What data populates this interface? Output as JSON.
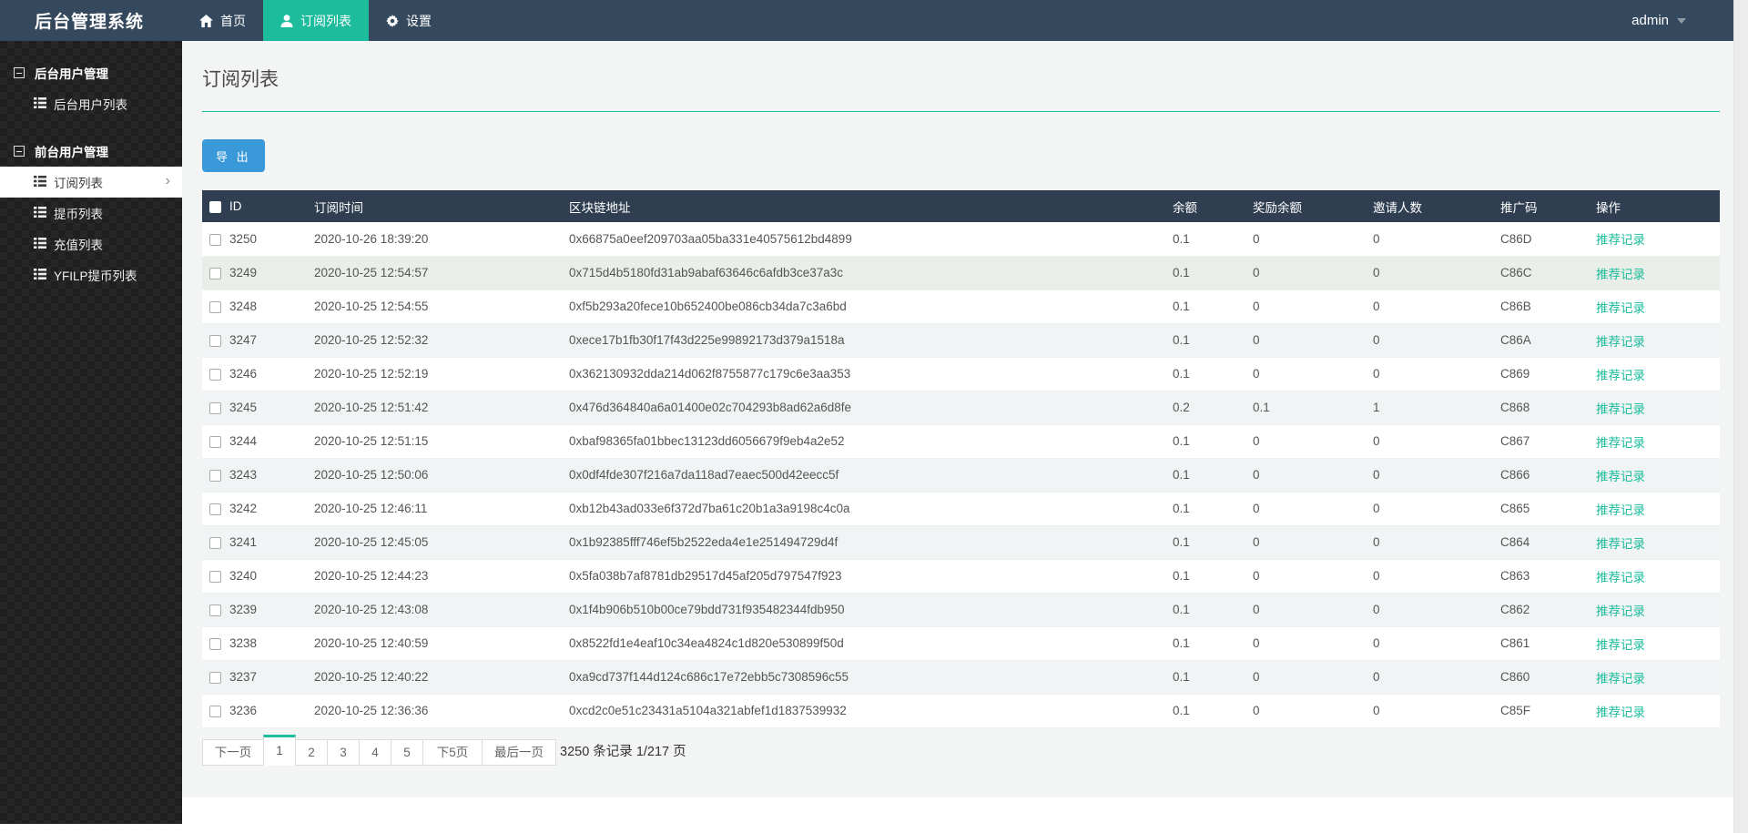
{
  "navbar": {
    "brand": "后台管理系统",
    "items": [
      {
        "label": "首页",
        "icon": "home-icon",
        "active": false
      },
      {
        "label": "订阅列表",
        "icon": "user-icon",
        "active": true
      },
      {
        "label": "设置",
        "icon": "gear-icon",
        "active": false
      }
    ],
    "user": "admin"
  },
  "sidebar": {
    "sections": [
      {
        "title": "后台用户管理",
        "items": [
          {
            "label": "后台用户列表",
            "active": false
          }
        ]
      },
      {
        "title": "前台用户管理",
        "items": [
          {
            "label": "订阅列表",
            "active": true
          },
          {
            "label": "提币列表",
            "active": false
          },
          {
            "label": "充值列表",
            "active": false
          },
          {
            "label": "YFILP提币列表",
            "active": false
          }
        ]
      }
    ]
  },
  "page": {
    "title": "订阅列表",
    "export_label": "导 出"
  },
  "table": {
    "headers": [
      "ID",
      "订阅时间",
      "区块链地址",
      "余额",
      "奖励余额",
      "邀请人数",
      "推广码",
      "操作"
    ],
    "action_label": "推荐记录",
    "rows": [
      {
        "id": "3250",
        "time": "2020-10-26 18:39:20",
        "address": "0x66875a0eef209703aa05ba331e40575612bd4899",
        "balance": "0.1",
        "reward": "0",
        "invites": "0",
        "code": "C86D"
      },
      {
        "id": "3249",
        "time": "2020-10-25 12:54:57",
        "address": "0x715d4b5180fd31ab9abaf63646c6afdb3ce37a3c",
        "balance": "0.1",
        "reward": "0",
        "invites": "0",
        "code": "C86C"
      },
      {
        "id": "3248",
        "time": "2020-10-25 12:54:55",
        "address": "0xf5b293a20fece10b652400be086cb34da7c3a6bd",
        "balance": "0.1",
        "reward": "0",
        "invites": "0",
        "code": "C86B"
      },
      {
        "id": "3247",
        "time": "2020-10-25 12:52:32",
        "address": "0xece17b1fb30f17f43d225e99892173d379a1518a",
        "balance": "0.1",
        "reward": "0",
        "invites": "0",
        "code": "C86A"
      },
      {
        "id": "3246",
        "time": "2020-10-25 12:52:19",
        "address": "0x362130932dda214d062f8755877c179c6e3aa353",
        "balance": "0.1",
        "reward": "0",
        "invites": "0",
        "code": "C869"
      },
      {
        "id": "3245",
        "time": "2020-10-25 12:51:42",
        "address": "0x476d364840a6a01400e02c704293b8ad62a6d8fe",
        "balance": "0.2",
        "reward": "0.1",
        "invites": "1",
        "code": "C868"
      },
      {
        "id": "3244",
        "time": "2020-10-25 12:51:15",
        "address": "0xbaf98365fa01bbec13123dd6056679f9eb4a2e52",
        "balance": "0.1",
        "reward": "0",
        "invites": "0",
        "code": "C867"
      },
      {
        "id": "3243",
        "time": "2020-10-25 12:50:06",
        "address": "0x0df4fde307f216a7da118ad7eaec500d42eecc5f",
        "balance": "0.1",
        "reward": "0",
        "invites": "0",
        "code": "C866"
      },
      {
        "id": "3242",
        "time": "2020-10-25 12:46:11",
        "address": "0xb12b43ad033e6f372d7ba61c20b1a3a9198c4c0a",
        "balance": "0.1",
        "reward": "0",
        "invites": "0",
        "code": "C865"
      },
      {
        "id": "3241",
        "time": "2020-10-25 12:45:05",
        "address": "0x1b92385fff746ef5b2522eda4e1e251494729d4f",
        "balance": "0.1",
        "reward": "0",
        "invites": "0",
        "code": "C864"
      },
      {
        "id": "3240",
        "time": "2020-10-25 12:44:23",
        "address": "0x5fa038b7af8781db29517d45af205d797547f923",
        "balance": "0.1",
        "reward": "0",
        "invites": "0",
        "code": "C863"
      },
      {
        "id": "3239",
        "time": "2020-10-25 12:43:08",
        "address": "0x1f4b906b510b00ce79bdd731f935482344fdb950",
        "balance": "0.1",
        "reward": "0",
        "invites": "0",
        "code": "C862"
      },
      {
        "id": "3238",
        "time": "2020-10-25 12:40:59",
        "address": "0x8522fd1e4eaf10c34ea4824c1d820e530899f50d",
        "balance": "0.1",
        "reward": "0",
        "invites": "0",
        "code": "C861"
      },
      {
        "id": "3237",
        "time": "2020-10-25 12:40:22",
        "address": "0xa9cd737f144d124c686c17e72ebb5c7308596c55",
        "balance": "0.1",
        "reward": "0",
        "invites": "0",
        "code": "C860"
      },
      {
        "id": "3236",
        "time": "2020-10-25 12:36:36",
        "address": "0xcd2c0e51c23431a5104a321abfef1d1837539932",
        "balance": "0.1",
        "reward": "0",
        "invites": "0",
        "code": "C85F"
      }
    ]
  },
  "pagination": {
    "buttons": [
      {
        "label": "下一页",
        "kind": "prev",
        "active": false
      },
      {
        "label": "1",
        "kind": "num",
        "active": true
      },
      {
        "label": "2",
        "kind": "num",
        "active": false
      },
      {
        "label": "3",
        "kind": "num",
        "active": false
      },
      {
        "label": "4",
        "kind": "num",
        "active": false
      },
      {
        "label": "5",
        "kind": "num",
        "active": false
      },
      {
        "label": "下5页",
        "kind": "next5",
        "active": false
      },
      {
        "label": "最后一页",
        "kind": "last",
        "active": false
      }
    ],
    "summary": "3250 条记录 1/217 页"
  },
  "colors": {
    "navbar_bg": "#34495e",
    "accent_green": "#1dbc9c",
    "table_header_bg": "#2f3e50",
    "primary_button": "#3a99d9",
    "content_bg": "#f3f4f4",
    "sidebar_bg": "#1f1f1f",
    "link_green": "#1cbc9c"
  }
}
